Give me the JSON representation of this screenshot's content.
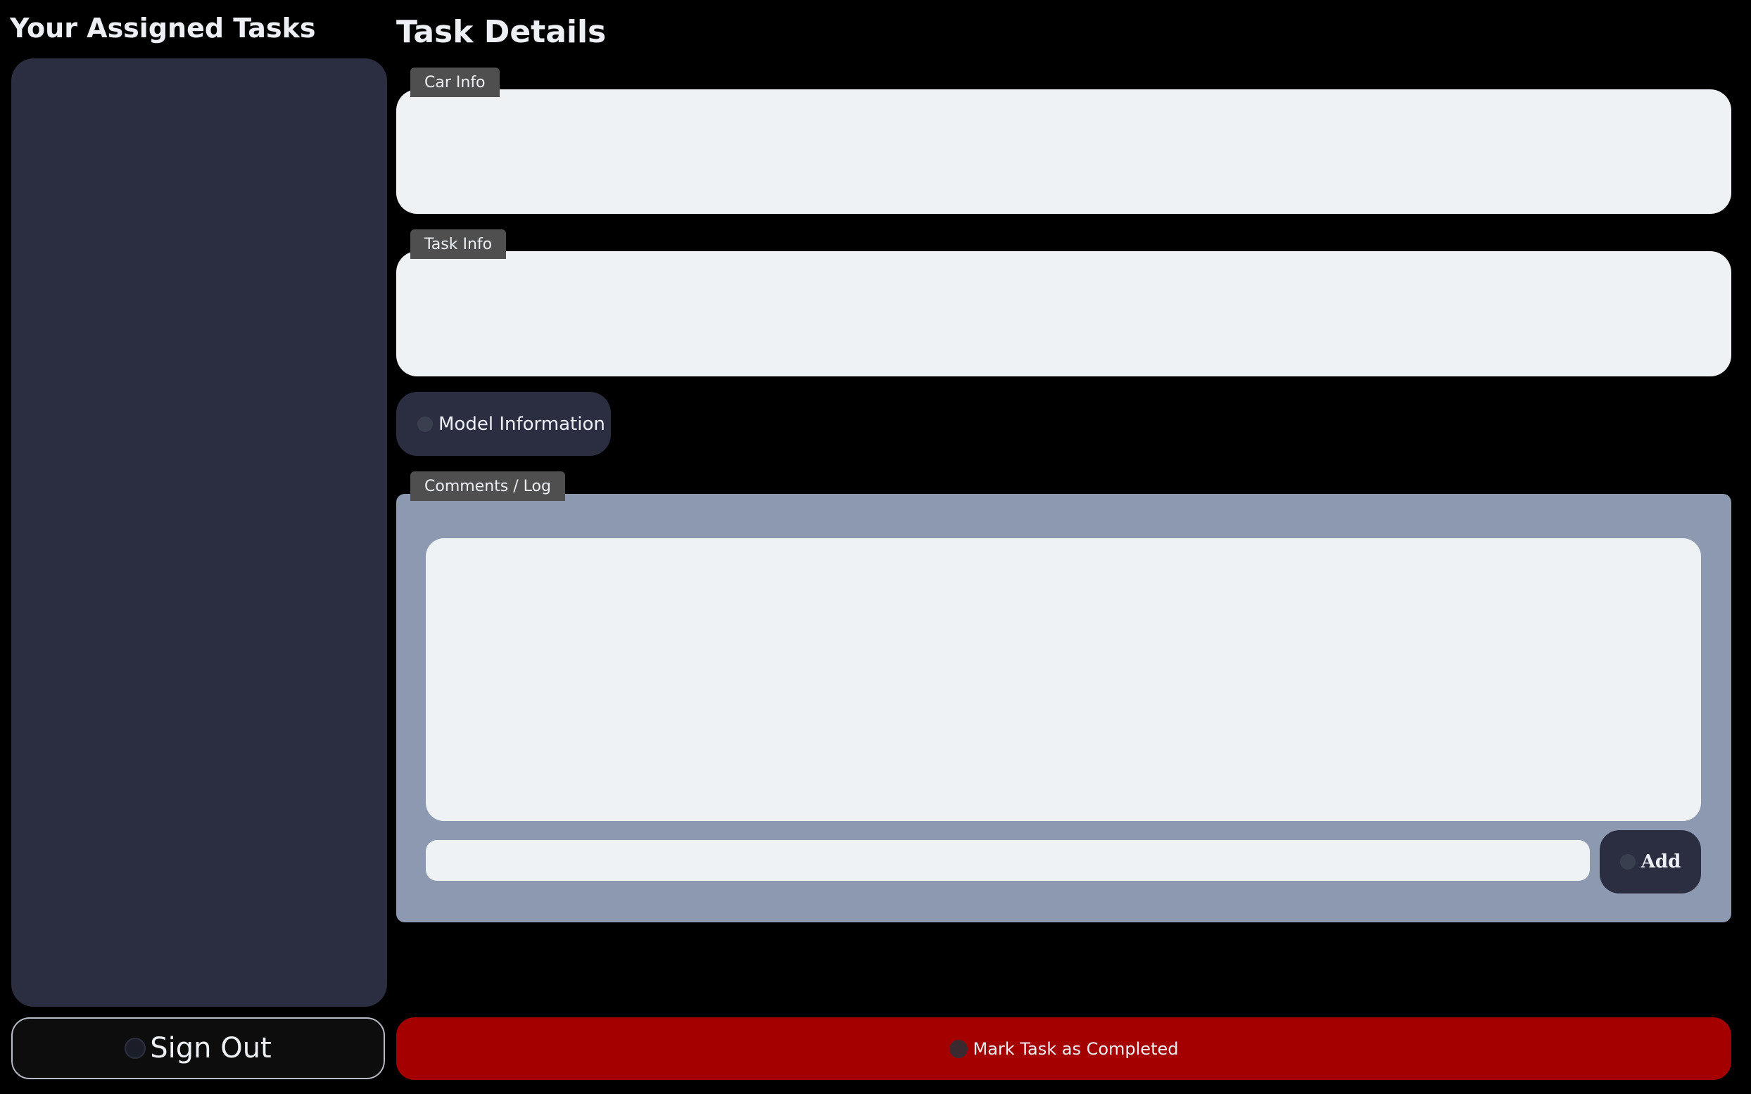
{
  "left_panel": {
    "heading": "Your Assigned Tasks",
    "tasks": [],
    "sign_out_label": "Sign Out",
    "sign_out_icon": "sign-out-icon"
  },
  "details": {
    "heading": "Task Details",
    "car_info": {
      "label": "Car Info",
      "text": ""
    },
    "task_info": {
      "label": "Task Info",
      "text": ""
    },
    "model_button": {
      "label": "Model Information",
      "icon": "info-icon"
    },
    "comments": {
      "label": "Comments / Log",
      "log_text": "",
      "input_value": "",
      "input_placeholder": "",
      "add_label": "Add",
      "add_icon": "add-icon"
    },
    "complete_button": {
      "label": "Mark Task as Completed",
      "icon": "check-icon"
    }
  },
  "colors": {
    "background": "#000000",
    "panel": "#2b2e41",
    "info_box": "#eef2f5",
    "comments_panel": "#8c99b0",
    "tab": "#4f4f4f",
    "complete": "#a40000"
  }
}
